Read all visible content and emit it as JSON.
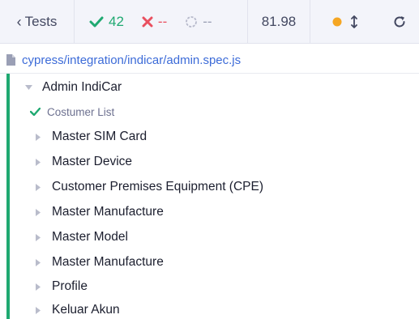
{
  "toolbar": {
    "back_label": "Tests",
    "passed": "42",
    "failed": "--",
    "pending": "--",
    "duration": "81.98",
    "colors": {
      "pass": "#1fa971",
      "fail": "#e94f5f",
      "pending": "#9a9fb5",
      "running_dot": "#f5a623"
    }
  },
  "spec": {
    "path": "cypress/integration/indicar/admin.spec.js"
  },
  "tree": {
    "suite": "Admin IndiCar",
    "passed_test": "Costumer List",
    "items": [
      "Master SIM Card",
      "Master Device",
      "Customer Premises Equipment (CPE)",
      "Master Manufacture",
      "Master Model",
      "Master Manufacture",
      "Profile",
      "Keluar Akun"
    ]
  },
  "icons": {
    "back": "chevron-left-icon",
    "pass": "check-icon",
    "fail": "x-icon",
    "pending": "circle-spinner-icon",
    "running": "orange-dot-icon",
    "scroll": "up-down-arrow-icon",
    "reload": "reload-icon",
    "file": "file-icon",
    "suite_open": "triangle-down-icon",
    "collapsed": "triangle-right-icon"
  }
}
